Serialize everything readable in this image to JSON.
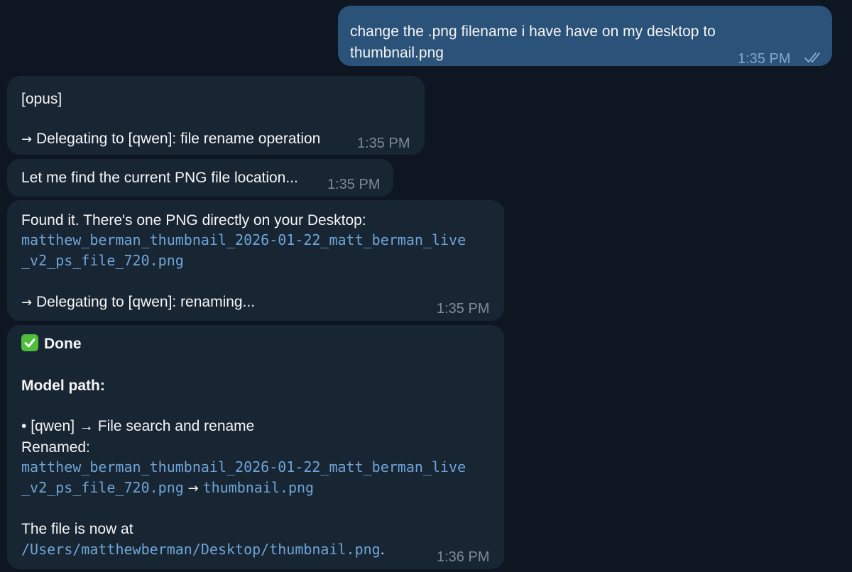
{
  "messages": {
    "m1": {
      "text_line1": "change the .png filename i have have on my desktop to",
      "text_line2": "thumbnail.png",
      "time": "1:35 PM"
    },
    "m2": {
      "tag": "[opus]",
      "delegation_arrow": "→",
      "delegation_text": "Delegating to [qwen]: file rename operation",
      "time": "1:35 PM"
    },
    "m3": {
      "text": "Let me find the current PNG file location...",
      "time": "1:35 PM"
    },
    "m4": {
      "intro": "Found it. There's one PNG directly on your Desktop:",
      "filename_line1": "matthew_berman_thumbnail_2026-01-22_matt_berman_live",
      "filename_line2": "_v2_ps_file_720.png",
      "delegation_arrow": "→",
      "delegation_text": "Delegating to [qwen]: renaming...",
      "time": "1:35 PM"
    },
    "m5": {
      "done_label": "Done",
      "model_path_label": "Model path:",
      "bullet": "•",
      "path_item": "[qwen] → File search and rename",
      "renamed_label": "Renamed:",
      "old_name_line1": "matthew_berman_thumbnail_2026-01-22_matt_berman_live",
      "old_name_line2": "_v2_ps_file_720.png",
      "rename_arrow": "→",
      "new_name": "thumbnail.png",
      "now_at_label": "The file is now at",
      "final_path": "/Users/matthewberman/Desktop/thumbnail.png",
      "final_period": ".",
      "time": "1:36 PM"
    }
  },
  "icons": {
    "read_receipt": "double-check-icon",
    "done": "check-mark-button-icon"
  },
  "colors": {
    "background": "#0e1621",
    "incoming_bubble": "#182533",
    "outgoing_bubble": "#2b5278",
    "code_text": "#6fa5d8",
    "done_check": "#4fbe3b"
  }
}
